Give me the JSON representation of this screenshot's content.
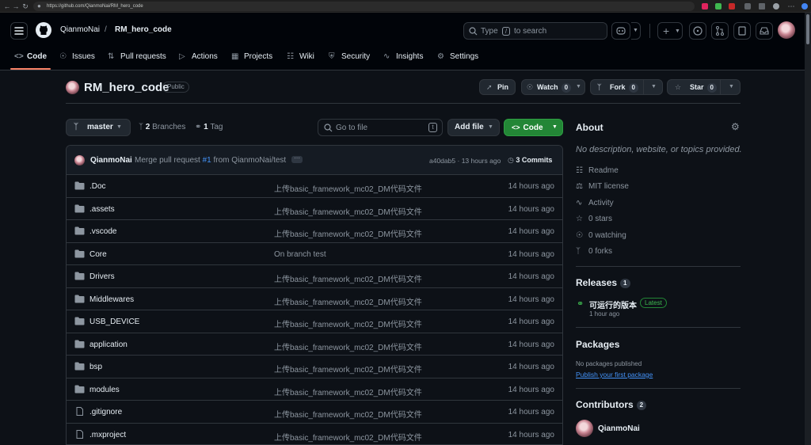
{
  "browser": {
    "url": "https://github.com/QianmoNai/RM_hero_code"
  },
  "header": {
    "owner": "QianmoNai",
    "separator": "/",
    "repo": "RM_hero_code",
    "search_prefix": "Type",
    "search_key": "/",
    "search_suffix": "to search",
    "plus_label": "+"
  },
  "tabs": [
    {
      "label": "Code",
      "icon": "code-icon"
    },
    {
      "label": "Issues",
      "icon": "issue-icon"
    },
    {
      "label": "Pull requests",
      "icon": "pull-request-icon"
    },
    {
      "label": "Actions",
      "icon": "play-icon"
    },
    {
      "label": "Projects",
      "icon": "table-icon"
    },
    {
      "label": "Wiki",
      "icon": "book-icon"
    },
    {
      "label": "Security",
      "icon": "shield-icon"
    },
    {
      "label": "Insights",
      "icon": "graph-icon"
    },
    {
      "label": "Settings",
      "icon": "gear-icon"
    }
  ],
  "repo": {
    "title": "RM_hero_code",
    "visibility": "Public",
    "pin_label": "Pin",
    "watch_label": "Watch",
    "watch_count": "0",
    "fork_label": "Fork",
    "fork_count": "0",
    "star_label": "Star",
    "star_count": "0"
  },
  "toolbar": {
    "branch": "master",
    "branches_count": "2",
    "branches_label": "Branches",
    "tags_count": "1",
    "tags_label": "Tag",
    "goto_placeholder": "Go to file",
    "goto_key": "t",
    "add_file_label": "Add file",
    "code_label": "Code"
  },
  "commit": {
    "author": "QianmoNai",
    "message_prefix": "Merge pull request",
    "pr_ref": "#1",
    "message_suffix": "from QianmoNai/test",
    "hash": "a40dab5",
    "sep": "·",
    "age": "13 hours ago",
    "commits_label": "3 Commits"
  },
  "files": [
    {
      "name": ".Doc",
      "type": "folder",
      "message": "上传basic_framework_mc02_DM代码文件",
      "time": "14 hours ago"
    },
    {
      "name": ".assets",
      "type": "folder",
      "message": "上传basic_framework_mc02_DM代码文件",
      "time": "14 hours ago"
    },
    {
      "name": ".vscode",
      "type": "folder",
      "message": "上传basic_framework_mc02_DM代码文件",
      "time": "14 hours ago"
    },
    {
      "name": "Core",
      "type": "folder",
      "message": "On branch test",
      "time": "14 hours ago"
    },
    {
      "name": "Drivers",
      "type": "folder",
      "message": "上传basic_framework_mc02_DM代码文件",
      "time": "14 hours ago"
    },
    {
      "name": "Middlewares",
      "type": "folder",
      "message": "上传basic_framework_mc02_DM代码文件",
      "time": "14 hours ago"
    },
    {
      "name": "USB_DEVICE",
      "type": "folder",
      "message": "上传basic_framework_mc02_DM代码文件",
      "time": "14 hours ago"
    },
    {
      "name": "application",
      "type": "folder",
      "message": "上传basic_framework_mc02_DM代码文件",
      "time": "14 hours ago"
    },
    {
      "name": "bsp",
      "type": "folder",
      "message": "上传basic_framework_mc02_DM代码文件",
      "time": "14 hours ago"
    },
    {
      "name": "modules",
      "type": "folder",
      "message": "上传basic_framework_mc02_DM代码文件",
      "time": "14 hours ago"
    },
    {
      "name": ".gitignore",
      "type": "file",
      "message": "上传basic_framework_mc02_DM代码文件",
      "time": "14 hours ago"
    },
    {
      "name": ".mxproject",
      "type": "file",
      "message": "上传basic_framework_mc02_DM代码文件",
      "time": "14 hours ago"
    }
  ],
  "about": {
    "heading": "About",
    "description": "No description, website, or topics provided.",
    "links": [
      {
        "label": "Readme",
        "icon": "book-icon"
      },
      {
        "label": "MIT license",
        "icon": "law-icon"
      },
      {
        "label": "Activity",
        "icon": "pulse-icon"
      },
      {
        "label": "0 stars",
        "icon": "star-icon"
      },
      {
        "label": "0 watching",
        "icon": "eye-icon"
      },
      {
        "label": "0 forks",
        "icon": "fork-icon"
      }
    ]
  },
  "releases": {
    "heading": "Releases",
    "count": "1",
    "name": "可运行的版本",
    "badge": "Latest",
    "age": "1 hour ago"
  },
  "packages": {
    "heading": "Packages",
    "empty": "No packages published",
    "link": "Publish your first package"
  },
  "contributors": {
    "heading": "Contributors",
    "count": "2",
    "first": "QianmoNai"
  },
  "colors": {
    "accent_green": "#238636",
    "link_blue": "#4493f8",
    "tab_underline": "#f78166",
    "background": "#0d1117"
  }
}
